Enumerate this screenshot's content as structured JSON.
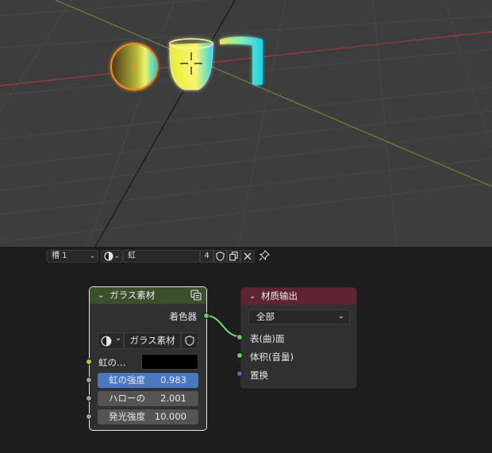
{
  "node_header": {
    "slot_label": "槽 1",
    "material_name": "虹",
    "user_count": "4"
  },
  "glass_node": {
    "title": "ガラス素材",
    "output_label": "着色器",
    "shader_name": "ガラス素材",
    "color_label": "虹の…",
    "color_value": "#000000",
    "fields": [
      {
        "label": "虹の強度",
        "value": "0.983"
      },
      {
        "label": "ハローの",
        "value": "2.001"
      },
      {
        "label": "発光強度",
        "value": "10.000"
      }
    ]
  },
  "output_node": {
    "title": "材质输出",
    "target": "全部",
    "inputs": [
      "表(曲)面",
      "体积(音量)",
      "置换"
    ]
  },
  "colors": {
    "glass_header": "#3c4f2c",
    "output_header": "#5f2430",
    "shader_socket": "#63c763",
    "color_socket": "#c7c729",
    "float_socket": "#a1a1a1",
    "vector_socket": "#6363c7",
    "selected_field": "#4a78c0"
  }
}
